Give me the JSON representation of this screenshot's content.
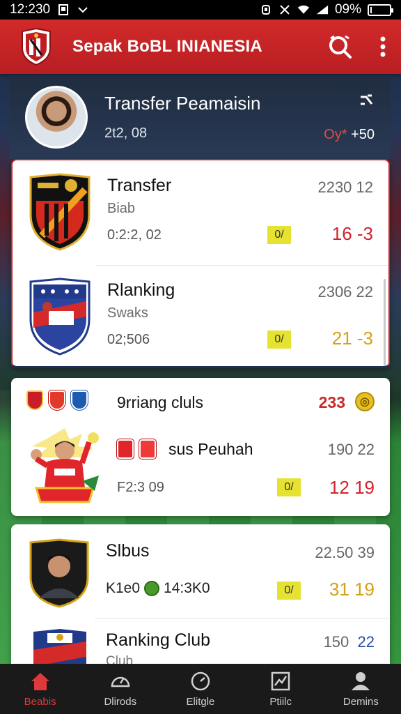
{
  "status_bar": {
    "time": "12:230",
    "battery": "09%",
    "battery_level": 0.09
  },
  "app_bar": {
    "title": "Sepak BoBL INIANESIA",
    "search_icon": "search-icon",
    "menu_icon": "more-vertical-icon"
  },
  "hero": {
    "title": "Transfer Peamaisin",
    "subtitle": "2t2, 08",
    "stat_red": "Oy*",
    "stat_white": "+50",
    "icon": "swap-icon"
  },
  "card1": {
    "rows": [
      {
        "name": "Transfer",
        "sub": "Biab",
        "date": "0:2:2, 02",
        "top_number": "2230  12",
        "badge": "0/",
        "score": "16  -3",
        "score_color": "#d0232e"
      },
      {
        "name": "Rlanking",
        "sub": "Swaks",
        "date": "02;506",
        "top_number": "2306  22",
        "badge": "0/",
        "score": "21  -3",
        "score_color": "#d4a214"
      }
    ]
  },
  "card2": {
    "title": "9rriang cluls",
    "count": "233",
    "mid_text": "sus Peuhah",
    "mid_number": "190  22",
    "date": "F2:3 09",
    "badge": "0/",
    "score": "12  19"
  },
  "card3": {
    "title": "Slbus",
    "number": "22.50  39",
    "line_left": "K1e0",
    "line_right": "14:3K0",
    "badge": "0/",
    "score": "31  19",
    "row2_name": "Ranking Club",
    "row2_sub": "Club",
    "row2_num_a": "150",
    "row2_num_b": "22"
  },
  "bottom_nav": [
    {
      "label": "Beabis",
      "icon": "home-icon",
      "active": true
    },
    {
      "label": "Dlirods",
      "icon": "gauge-icon",
      "active": false
    },
    {
      "label": "Elitgle",
      "icon": "clock-icon",
      "active": false
    },
    {
      "label": "Ptiilc",
      "icon": "chart-icon",
      "active": false
    },
    {
      "label": "Demins",
      "icon": "person-icon",
      "active": false
    }
  ],
  "colors": {
    "brand_red": "#c8242a",
    "score_red": "#d0232e",
    "score_gold": "#d4a214",
    "badge_yellow": "#e6e232"
  }
}
